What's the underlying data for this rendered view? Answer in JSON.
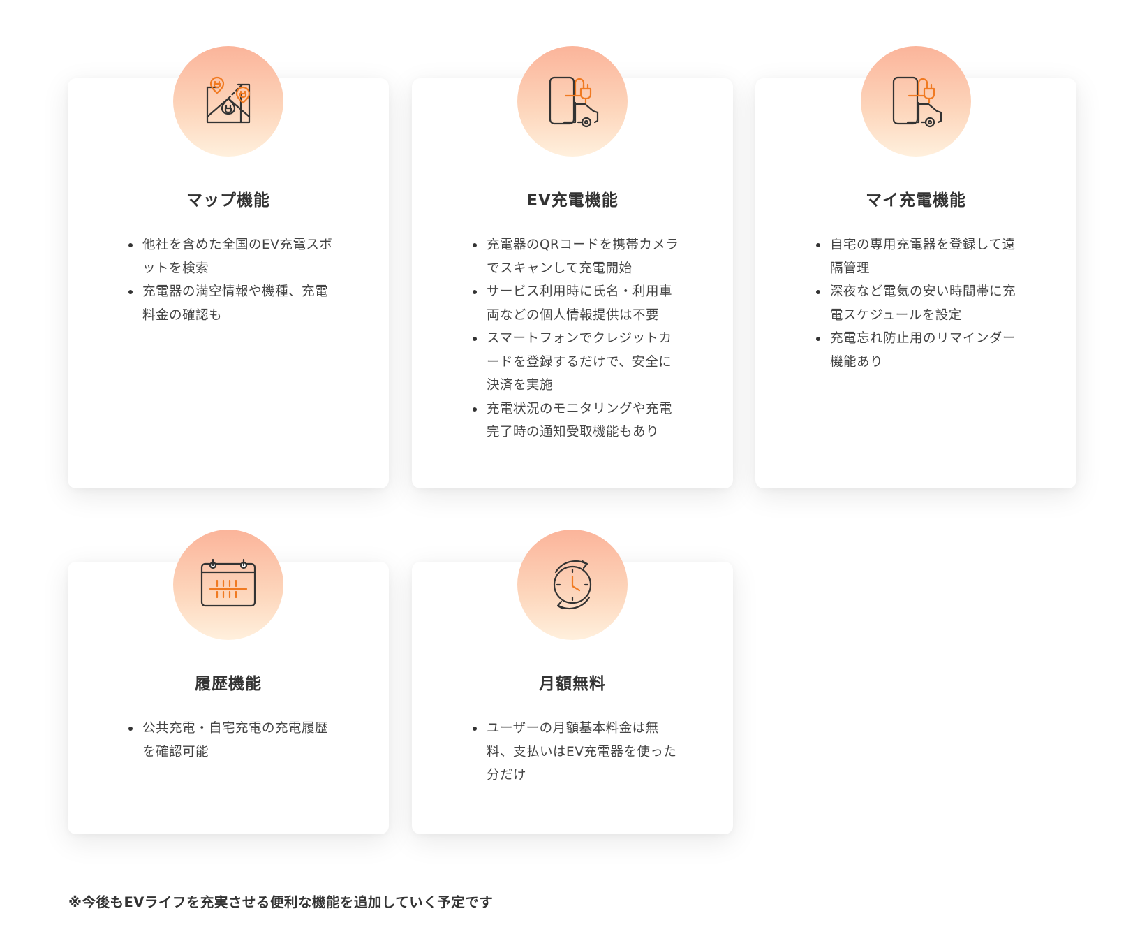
{
  "cards": [
    {
      "icon": "map-charging-icon",
      "title": "マップ機能",
      "items": [
        "他社を含めた全国のEV充電スポットを検索",
        "充電器の満空情報や機種、充電料金の確認も"
      ]
    },
    {
      "icon": "phone-charger-car-icon",
      "title": "EV充電機能",
      "items": [
        "充電器のQRコードを携帯カメラでスキャンして充電開始",
        "サービス利用時に氏名・利用車両などの個人情報提供は不要",
        "スマートフォンでクレジットカードを登録するだけで、安全に決済を実施",
        "充電状況のモニタリングや充電完了時の通知受取機能もあり"
      ]
    },
    {
      "icon": "phone-charger-car-icon",
      "title": "マイ充電機能",
      "items": [
        "自宅の専用充電器を登録して遠隔管理",
        "深夜など電気の安い時間帯に充電スケジュールを設定",
        "充電忘れ防止用のリマインダー機能あり"
      ]
    },
    {
      "icon": "calendar-icon",
      "title": "履歴機能",
      "items": [
        "公共充電・自宅充電の充電履歴を確認可能"
      ]
    },
    {
      "icon": "clock-cycle-icon",
      "title": "月額無料",
      "items": [
        "ユーザーの月額基本料金は無料、支払いはEV充電器を使った分だけ"
      ]
    }
  ],
  "footnote": "※今後もEVライフを充実させる便利な機能を追加していく予定です",
  "colors": {
    "accent": "#f07a22",
    "icon_stroke": "#333333",
    "circle_top": "#fbb49a",
    "circle_bottom": "#fff0dd"
  }
}
